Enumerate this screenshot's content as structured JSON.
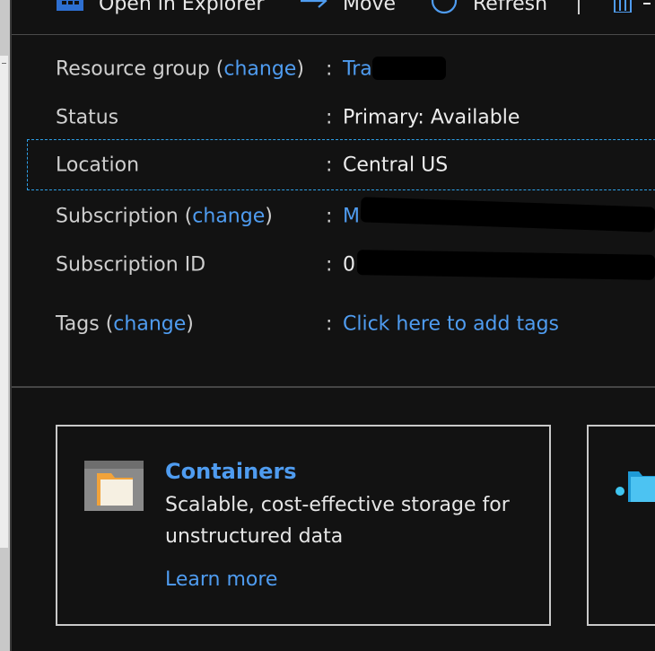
{
  "toolbar": {
    "open_explorer": "Open in Explorer",
    "move": "Move",
    "refresh": "Refresh"
  },
  "essentials": {
    "resource_group_label": "Resource group",
    "change_label": "change",
    "resource_group_value": "Transport",
    "status_label": "Status",
    "status_value": "Primary: Available",
    "location_label": "Location",
    "location_value": "Central US",
    "subscription_label": "Subscription",
    "subscription_value": "M",
    "subscription_id_label": "Subscription ID",
    "subscription_id_value": "0",
    "tags_label": "Tags",
    "tags_value": "Click here to add tags"
  },
  "cards": [
    {
      "title": "Containers",
      "description": "Scalable, cost-effective storage for unstructured data",
      "link": "Learn more"
    }
  ],
  "colors": {
    "background": "#121212",
    "link": "#4f9cf0",
    "selection_border": "#2ea0e8"
  },
  "icons": [
    "storage-explorer-icon",
    "move-arrow-icon",
    "refresh-icon",
    "delete-icon",
    "container-folder-icon",
    "file-share-icon"
  ]
}
